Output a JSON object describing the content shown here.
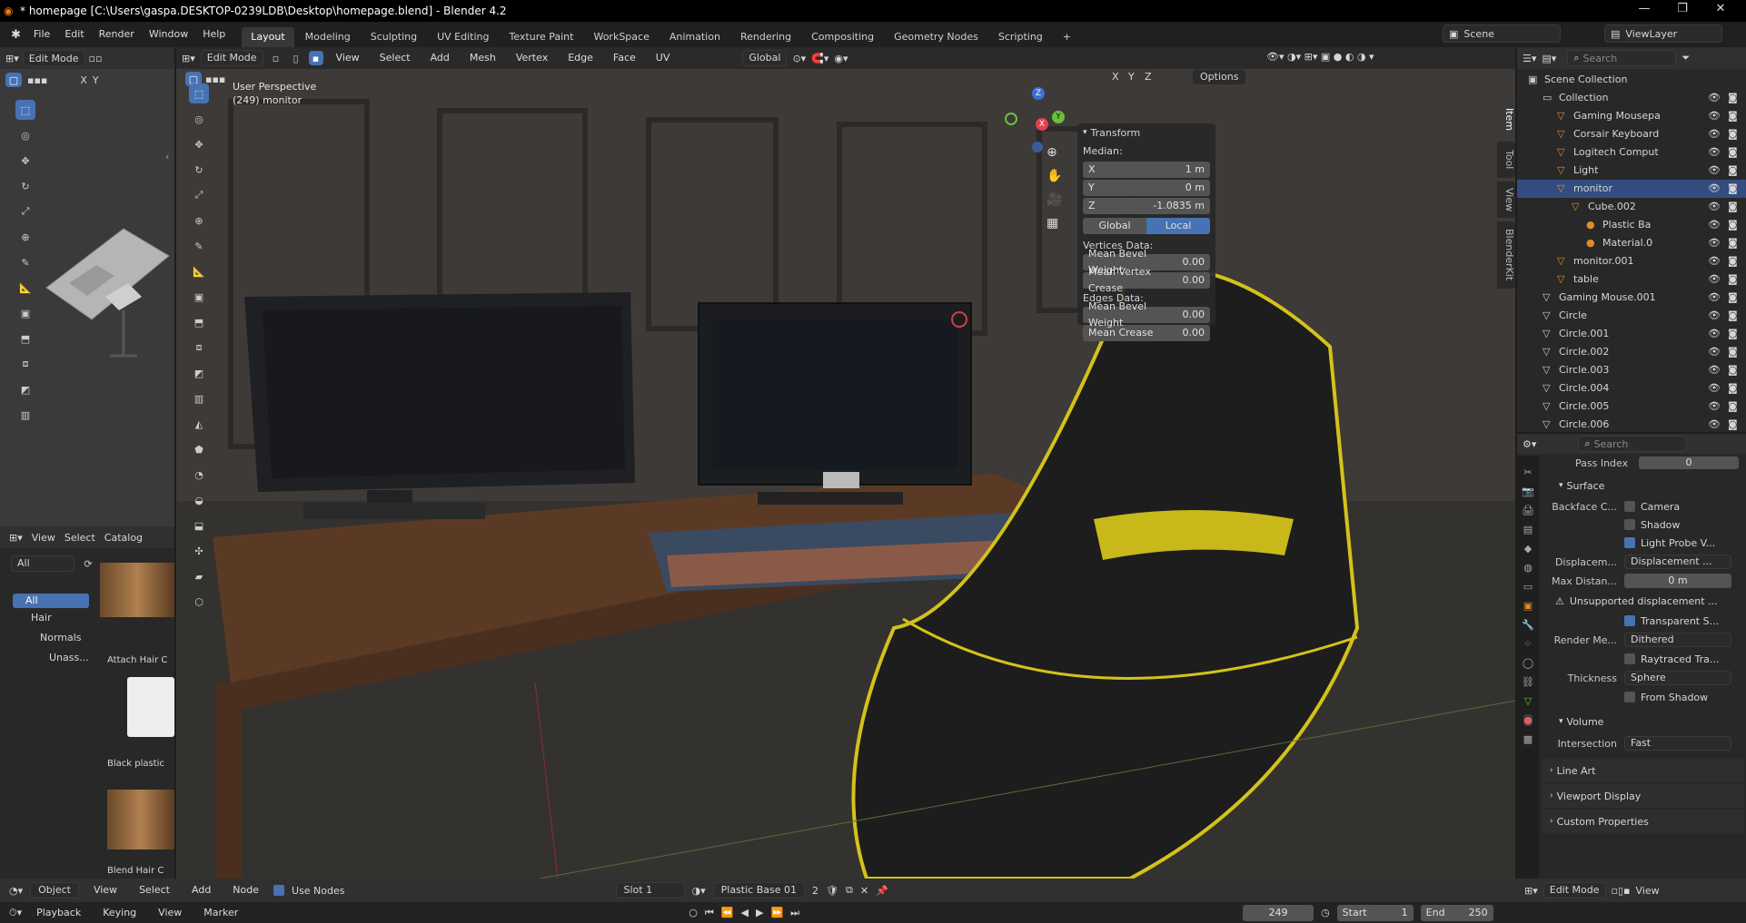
{
  "titlebar": {
    "title": "* homepage [C:\\Users\\gaspa.DESKTOP-0239LDB\\Desktop\\homepage.blend] - Blender 4.2"
  },
  "menu": [
    "File",
    "Edit",
    "Render",
    "Window",
    "Help"
  ],
  "workspaces": [
    "Layout",
    "Modeling",
    "Sculpting",
    "UV Editing",
    "Texture Paint",
    "WorkSpace",
    "Animation",
    "Rendering",
    "Compositing",
    "Geometry Nodes",
    "Scripting"
  ],
  "active_workspace": "Layout",
  "scene": {
    "name": "Scene",
    "view_layer": "ViewLayer"
  },
  "left_editor": {
    "mode": "Edit Mode",
    "axis_x": "X",
    "axis_y": "Y"
  },
  "viewport": {
    "mode": "Edit Mode",
    "menus": [
      "View",
      "Select",
      "Add",
      "Mesh",
      "Vertex",
      "Edge",
      "Face",
      "UV"
    ],
    "orientation": "Global",
    "options": "Options",
    "overlay_text_1": "User Perspective",
    "overlay_text_2": "(249) monitor",
    "axes": [
      "X",
      "Y",
      "Z"
    ]
  },
  "transform": {
    "title": "Transform",
    "median": "Median:",
    "x_label": "X",
    "x_val": "1 m",
    "y_label": "Y",
    "y_val": "0 m",
    "z_label": "Z",
    "z_val": "-1.0835 m",
    "global": "Global",
    "local": "Local",
    "vertices_data": "Vertices Data:",
    "mean_bevel_weight": "Mean Bevel Weight",
    "mbw_val": "0.00",
    "mean_vertex_crease": "Mean Vertex Crease",
    "mvc_val": "0.00",
    "edges_data": "Edges Data:",
    "mean_bevel_weight_e": "Mean Bevel Weight",
    "mbwe_val": "0.00",
    "mean_crease": "Mean Crease",
    "mc_val": "0.00"
  },
  "side_tabs": [
    "Item",
    "Tool",
    "View",
    "BlenderKit"
  ],
  "asset_browser": {
    "menus": [
      "View",
      "Select",
      "Catalog"
    ],
    "filter": "All",
    "tree": [
      "All",
      "Hair",
      "Normals",
      "Unass..."
    ],
    "assets": [
      "Attach Hair C",
      "Black plastic",
      "Blend Hair C"
    ]
  },
  "outliner": {
    "search": "Search",
    "rows": [
      {
        "name": "Scene Collection",
        "indent": 0
      },
      {
        "name": "Collection",
        "indent": 1
      },
      {
        "name": "Gaming Mousepa",
        "indent": 2
      },
      {
        "name": "Corsair Keyboard",
        "indent": 2
      },
      {
        "name": "Logitech Comput",
        "indent": 2
      },
      {
        "name": "Light",
        "indent": 2
      },
      {
        "name": "monitor",
        "indent": 2,
        "selected": true
      },
      {
        "name": "Cube.002",
        "indent": 3
      },
      {
        "name": "Plastic Ba",
        "indent": 4
      },
      {
        "name": "Material.0",
        "indent": 4
      },
      {
        "name": "monitor.001",
        "indent": 2
      },
      {
        "name": "table",
        "indent": 2
      },
      {
        "name": "Gaming Mouse.001",
        "indent": 1
      },
      {
        "name": "Circle",
        "indent": 1
      },
      {
        "name": "Circle.001",
        "indent": 1
      },
      {
        "name": "Circle.002",
        "indent": 1
      },
      {
        "name": "Circle.003",
        "indent": 1
      },
      {
        "name": "Circle.004",
        "indent": 1
      },
      {
        "name": "Circle.005",
        "indent": 1
      },
      {
        "name": "Circle.006",
        "indent": 1
      }
    ]
  },
  "properties": {
    "search": "Search",
    "pass_index_label": "Pass Index",
    "pass_index_val": "0",
    "surface": "Surface",
    "backface_label": "Backface C...",
    "camera": "Camera",
    "shadow": "Shadow",
    "light_probe": "Light Probe V...",
    "displacement_label": "Displacem...",
    "displacement_val": "Displacement ...",
    "max_distance_label": "Max Distan...",
    "max_distance_val": "0 m",
    "warning": "Unsupported displacement ...",
    "transparent": "Transparent S...",
    "render_method_label": "Render Me...",
    "render_method_val": "Dithered",
    "raytraced": "Raytraced Tra...",
    "thickness_label": "Thickness",
    "thickness_val": "Sphere",
    "from_shadow": "From Shadow",
    "volume": "Volume",
    "intersection_label": "Intersection",
    "intersection_val": "Fast",
    "line_art": "Line Art",
    "viewport_display": "Viewport Display",
    "custom_properties": "Custom Properties"
  },
  "node_header": {
    "object": "Object",
    "menus": [
      "View",
      "Select",
      "Add",
      "Node"
    ],
    "use_nodes": "Use Nodes",
    "slot": "Slot 1",
    "material": "Plastic Base 01",
    "users": "2"
  },
  "bottom_right_header": {
    "mode": "Edit Mode",
    "view": "View"
  },
  "timeline": {
    "menus": [
      "Playback",
      "Keying",
      "View",
      "Marker"
    ],
    "frame": "249",
    "start_label": "Start",
    "start": "1",
    "end_label": "End",
    "end": "250"
  },
  "colors": {
    "accent": "#4772b3",
    "selected_row": "#334d80",
    "yellow": "#d4c21a"
  }
}
